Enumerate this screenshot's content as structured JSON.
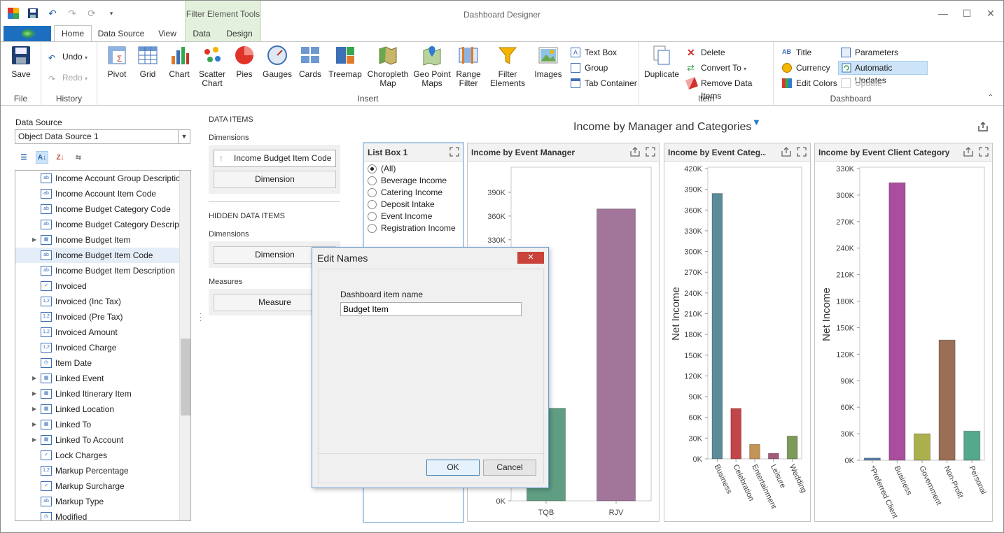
{
  "window": {
    "title": "Dashboard Designer",
    "context_group": "Filter Element Tools"
  },
  "tabs": [
    "Home",
    "Data Source",
    "View",
    "Data",
    "Design"
  ],
  "ribbon": {
    "file": {
      "label": "File",
      "save": "Save"
    },
    "history": {
      "label": "History",
      "undo": "Undo",
      "redo": "Redo"
    },
    "insert": {
      "label": "Insert",
      "pivot": "Pivot",
      "grid": "Grid",
      "chart": "Chart",
      "scatter": "Scatter\nChart",
      "pies": "Pies",
      "gauges": "Gauges",
      "cards": "Cards",
      "treemap": "Treemap",
      "choropleth": "Choropleth\nMap",
      "geopoint": "Geo Point\nMaps",
      "range": "Range\nFilter",
      "filter": "Filter\nElements",
      "images": "Images",
      "textbox": "Text Box",
      "group": "Group",
      "tabcontainer": "Tab Container"
    },
    "item": {
      "label": "Item",
      "duplicate": "Duplicate",
      "delete": "Delete",
      "convert": "Convert To",
      "remove": "Remove Data Items"
    },
    "dashboard": {
      "label": "Dashboard",
      "title": "Title",
      "currency": "Currency",
      "editcolors": "Edit Colors",
      "parameters": "Parameters",
      "autoupdates": "Automatic Updates",
      "update": "Update"
    }
  },
  "datasource": {
    "label": "Data Source",
    "value": "Object Data Source 1"
  },
  "fields": [
    {
      "label": "Income Account Group Description",
      "type": "ab"
    },
    {
      "label": "Income Account Item Code",
      "type": "ab"
    },
    {
      "label": "Income Budget Category Code",
      "type": "ab"
    },
    {
      "label": "Income Budget Category Descripti...",
      "type": "ab"
    },
    {
      "label": "Income Budget Item",
      "type": "tbl",
      "expandable": true
    },
    {
      "label": "Income Budget Item Code",
      "type": "ab",
      "selected": true
    },
    {
      "label": "Income Budget Item Description",
      "type": "ab"
    },
    {
      "label": "Invoiced",
      "type": "chk"
    },
    {
      "label": "Invoiced (Inc Tax)",
      "type": "num"
    },
    {
      "label": "Invoiced (Pre Tax)",
      "type": "num"
    },
    {
      "label": "Invoiced Amount",
      "type": "num"
    },
    {
      "label": "Invoiced Charge",
      "type": "num"
    },
    {
      "label": "Item Date",
      "type": "date"
    },
    {
      "label": "Linked Event",
      "type": "tbl",
      "expandable": true
    },
    {
      "label": "Linked Itinerary Item",
      "type": "tbl",
      "expandable": true
    },
    {
      "label": "Linked Location",
      "type": "tbl",
      "expandable": true
    },
    {
      "label": "Linked To",
      "type": "tbl",
      "expandable": true
    },
    {
      "label": "Linked To Account",
      "type": "tbl",
      "expandable": true
    },
    {
      "label": "Lock Charges",
      "type": "chk"
    },
    {
      "label": "Markup Percentage",
      "type": "num"
    },
    {
      "label": "Markup Surcharge",
      "type": "chk"
    },
    {
      "label": "Markup Type",
      "type": "ab"
    },
    {
      "label": "Modified",
      "type": "date"
    }
  ],
  "dataitems": {
    "title": "DATA ITEMS",
    "dimensions_label": "Dimensions",
    "dimension_item": "Income Budget Item Code",
    "dimension_placeholder": "Dimension",
    "hidden_title": "HIDDEN DATA ITEMS",
    "hidden_dimensions_label": "Dimensions",
    "hidden_dimension_placeholder": "Dimension",
    "measures_label": "Measures",
    "measure_placeholder": "Measure"
  },
  "dashboard": {
    "title": "Income by Manager and Categories"
  },
  "listbox": {
    "title": "List Box 1",
    "items": [
      "(All)",
      "Beverage Income",
      "Catering Income",
      "Deposit Intake",
      "Event Income",
      "Registration Income"
    ]
  },
  "chart_data": [
    {
      "type": "bar",
      "title": "Income by Event Manager",
      "categories": [
        "TQB",
        "RJV"
      ],
      "values": [
        117000,
        369000
      ],
      "colors": [
        "#5f9e82",
        "#a2759a"
      ],
      "ylim": [
        0,
        420000
      ],
      "ticks": [
        "0K",
        "30K",
        "60K",
        "90K",
        "120K",
        "150K",
        "180K",
        "210K",
        "240K",
        "270K",
        "300K",
        "330K",
        "360K",
        "390K"
      ]
    },
    {
      "type": "bar",
      "title": "Income by Event Categ...",
      "ylabel": "Net Income",
      "categories": [
        "Business",
        "Celebration",
        "Entertainment",
        "Leisure",
        "Wedding"
      ],
      "values": [
        384000,
        73000,
        21000,
        8000,
        33000
      ],
      "colors": [
        "#5b8c99",
        "#c2454a",
        "#c39357",
        "#a35b7a",
        "#7c9a5a"
      ],
      "ylim": [
        0,
        420000
      ],
      "ticks": [
        "0K",
        "30K",
        "60K",
        "90K",
        "120K",
        "150K",
        "180K",
        "210K",
        "240K",
        "270K",
        "300K",
        "330K",
        "360K",
        "390K",
        "420K"
      ]
    },
    {
      "type": "bar",
      "title": "Income by Event Client Category",
      "ylabel": "Net Income",
      "categories": [
        "*Preferred Client",
        "Business",
        "Government",
        "Non-Profit",
        "Personal"
      ],
      "values": [
        2500,
        314000,
        30000,
        136000,
        33000
      ],
      "colors": [
        "#5a7fa8",
        "#a94d9e",
        "#aab04c",
        "#9a6f55",
        "#55a88b"
      ],
      "ylim": [
        0,
        330000
      ],
      "ticks": [
        "0K",
        "30K",
        "60K",
        "90K",
        "120K",
        "150K",
        "180K",
        "210K",
        "240K",
        "270K",
        "300K",
        "330K"
      ]
    }
  ],
  "dialog": {
    "title": "Edit Names",
    "label": "Dashboard item name",
    "value": "Budget Item",
    "ok": "OK",
    "cancel": "Cancel"
  }
}
